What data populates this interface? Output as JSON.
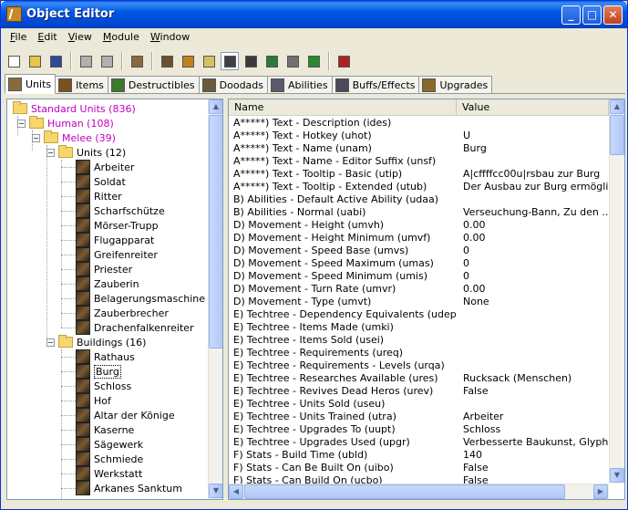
{
  "window": {
    "title": "Object Editor"
  },
  "menu": [
    {
      "key": "F",
      "rest": "ile"
    },
    {
      "key": "E",
      "rest": "dit"
    },
    {
      "key": "V",
      "rest": "iew"
    },
    {
      "key": "M",
      "rest": "odule"
    },
    {
      "key": "W",
      "rest": "indow"
    }
  ],
  "toolbar": [
    {
      "name": "new-icon",
      "color": "#FFFFFF",
      "pressed": false
    },
    {
      "name": "open-folder-icon",
      "color": "#E8C44A",
      "pressed": false
    },
    {
      "name": "save-icon",
      "color": "#2A4A9A",
      "pressed": false
    },
    {
      "name": "sep"
    },
    {
      "name": "copy-icon",
      "color": "#B0B0B0",
      "pressed": false
    },
    {
      "name": "paste-icon",
      "color": "#B0B0B0",
      "pressed": false
    },
    {
      "name": "sep"
    },
    {
      "name": "object-editor-icon",
      "color": "#8A6A3A",
      "pressed": false
    },
    {
      "name": "sep"
    },
    {
      "name": "terrain-editor-icon",
      "color": "#6A5030",
      "pressed": false
    },
    {
      "name": "trigger-editor-icon",
      "color": "#C08020",
      "pressed": false
    },
    {
      "name": "sound-editor-icon",
      "color": "#D8C060",
      "pressed": false
    },
    {
      "name": "object-editor-active-icon",
      "color": "#404040",
      "pressed": true
    },
    {
      "name": "campaign-editor-icon",
      "color": "#3A3A3A",
      "pressed": false
    },
    {
      "name": "ai-editor-icon",
      "color": "#2A7A3A",
      "pressed": false
    },
    {
      "name": "import-manager-icon",
      "color": "#707070",
      "pressed": false
    },
    {
      "name": "export-icon",
      "color": "#2A8A2A",
      "pressed": false
    },
    {
      "name": "sep"
    },
    {
      "name": "test-map-icon",
      "color": "#B02020",
      "pressed": false
    }
  ],
  "tabs": [
    {
      "label": "Units",
      "active": true,
      "icon": "units-tab-icon",
      "color": "#8A6A3A"
    },
    {
      "label": "Items",
      "active": false,
      "icon": "items-tab-icon",
      "color": "#7A5020"
    },
    {
      "label": "Destructibles",
      "active": false,
      "icon": "destructibles-tab-icon",
      "color": "#3A7A2A"
    },
    {
      "label": "Doodads",
      "active": false,
      "icon": "doodads-tab-icon",
      "color": "#6A5A3A"
    },
    {
      "label": "Abilities",
      "active": false,
      "icon": "abilities-tab-icon",
      "color": "#5A5A6A"
    },
    {
      "label": "Buffs/Effects",
      "active": false,
      "icon": "buffs-tab-icon",
      "color": "#4A4A5A"
    },
    {
      "label": "Upgrades",
      "active": false,
      "icon": "upgrades-tab-icon",
      "color": "#8A6A2A"
    }
  ],
  "tree": [
    {
      "label": "Standard Units (836)",
      "level": 0,
      "type": "folder",
      "toggle": "",
      "purple": true
    },
    {
      "label": "Human (108)",
      "level": 1,
      "type": "folder",
      "toggle": "−",
      "purple": true
    },
    {
      "label": "Melee (39)",
      "level": 2,
      "type": "folder",
      "toggle": "−",
      "purple": true
    },
    {
      "label": "Units (12)",
      "level": 3,
      "type": "folder",
      "toggle": "−",
      "purple": false
    },
    {
      "label": "Arbeiter",
      "level": 4,
      "type": "unit"
    },
    {
      "label": "Soldat",
      "level": 4,
      "type": "unit"
    },
    {
      "label": "Ritter",
      "level": 4,
      "type": "unit"
    },
    {
      "label": "Scharfschütze",
      "level": 4,
      "type": "unit"
    },
    {
      "label": "Mörser-Trupp",
      "level": 4,
      "type": "unit"
    },
    {
      "label": "Flugapparat",
      "level": 4,
      "type": "unit"
    },
    {
      "label": "Greifenreiter",
      "level": 4,
      "type": "unit"
    },
    {
      "label": "Priester",
      "level": 4,
      "type": "unit"
    },
    {
      "label": "Zauberin",
      "level": 4,
      "type": "unit"
    },
    {
      "label": "Belagerungsmaschine",
      "level": 4,
      "type": "unit"
    },
    {
      "label": "Zauberbrecher",
      "level": 4,
      "type": "unit"
    },
    {
      "label": "Drachenfalkenreiter",
      "level": 4,
      "type": "unit"
    },
    {
      "label": "Buildings (16)",
      "level": 3,
      "type": "folder",
      "toggle": "−",
      "purple": false
    },
    {
      "label": "Rathaus",
      "level": 4,
      "type": "unit"
    },
    {
      "label": "Burg",
      "level": 4,
      "type": "unit",
      "selected": true
    },
    {
      "label": "Schloss",
      "level": 4,
      "type": "unit"
    },
    {
      "label": "Hof",
      "level": 4,
      "type": "unit"
    },
    {
      "label": "Altar der Könige",
      "level": 4,
      "type": "unit"
    },
    {
      "label": "Kaserne",
      "level": 4,
      "type": "unit"
    },
    {
      "label": "Sägewerk",
      "level": 4,
      "type": "unit"
    },
    {
      "label": "Schmiede",
      "level": 4,
      "type": "unit"
    },
    {
      "label": "Werkstatt",
      "level": 4,
      "type": "unit"
    },
    {
      "label": "Arkanes Sanktum",
      "level": 4,
      "type": "unit"
    }
  ],
  "list": {
    "columns": [
      "Name",
      "Value"
    ],
    "rows": [
      {
        "name": "A*****) Text - Description (ides)",
        "value": ""
      },
      {
        "name": "A*****) Text - Hotkey (uhot)",
        "value": "U"
      },
      {
        "name": "A*****) Text - Name (unam)",
        "value": "Burg"
      },
      {
        "name": "A*****) Text - Name - Editor Suffix (unsf)",
        "value": ""
      },
      {
        "name": "A*****) Text - Tooltip - Basic (utip)",
        "value": "A|cffffcc00u|rsbau zur Burg"
      },
      {
        "name": "A*****) Text - Tooltip - Extended (utub)",
        "value": "Der Ausbau zur Burg ermöglic..."
      },
      {
        "name": "B) Abilities - Default Active Ability (udaa)",
        "value": ""
      },
      {
        "name": "B) Abilities - Normal (uabi)",
        "value": "Verseuchung-Bann, Zu den ..."
      },
      {
        "name": "D) Movement - Height (umvh)",
        "value": "0.00"
      },
      {
        "name": "D) Movement - Height Minimum (umvf)",
        "value": "0.00"
      },
      {
        "name": "D) Movement - Speed Base (umvs)",
        "value": "0"
      },
      {
        "name": "D) Movement - Speed Maximum (umas)",
        "value": "0"
      },
      {
        "name": "D) Movement - Speed Minimum (umis)",
        "value": "0"
      },
      {
        "name": "D) Movement - Turn Rate (umvr)",
        "value": "0.00"
      },
      {
        "name": "D) Movement - Type (umvt)",
        "value": "None"
      },
      {
        "name": "E) Techtree - Dependency Equivalents (udep)",
        "value": ""
      },
      {
        "name": "E) Techtree - Items Made (umki)",
        "value": ""
      },
      {
        "name": "E) Techtree - Items Sold (usei)",
        "value": ""
      },
      {
        "name": "E) Techtree - Requirements (ureq)",
        "value": ""
      },
      {
        "name": "E) Techtree - Requirements - Levels (urqa)",
        "value": ""
      },
      {
        "name": "E) Techtree - Researches Available (ures)",
        "value": "Rucksack (Menschen)"
      },
      {
        "name": "E) Techtree - Revives Dead Heros (urev)",
        "value": "False"
      },
      {
        "name": "E) Techtree - Units Sold (useu)",
        "value": ""
      },
      {
        "name": "E) Techtree - Units Trained (utra)",
        "value": "Arbeiter"
      },
      {
        "name": "E) Techtree - Upgrades To (uupt)",
        "value": "Schloss"
      },
      {
        "name": "E) Techtree - Upgrades Used (upgr)",
        "value": "Verbesserte Baukunst, Glyphe..."
      },
      {
        "name": "F) Stats - Build Time (ubld)",
        "value": "140"
      },
      {
        "name": "F) Stats - Can Be Built On (uibo)",
        "value": "False"
      },
      {
        "name": "F) Stats - Can Build On (ucbo)",
        "value": "False"
      }
    ]
  }
}
